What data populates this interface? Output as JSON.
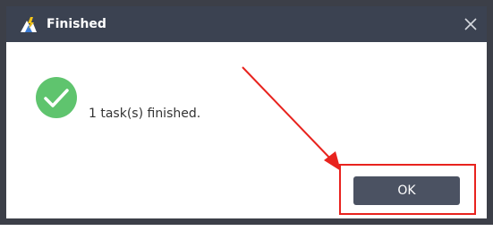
{
  "dialog": {
    "title": "Finished",
    "message": "1 task(s) finished.",
    "ok_label": "OK"
  },
  "icons": {
    "app": "app-logo-icon",
    "close": "close-icon",
    "status": "check-circle-icon"
  },
  "colors": {
    "titlebar": "#3b4251",
    "success_green": "#5fc46e",
    "ok_button": "#4b5262",
    "highlight_red": "#e8231e"
  }
}
